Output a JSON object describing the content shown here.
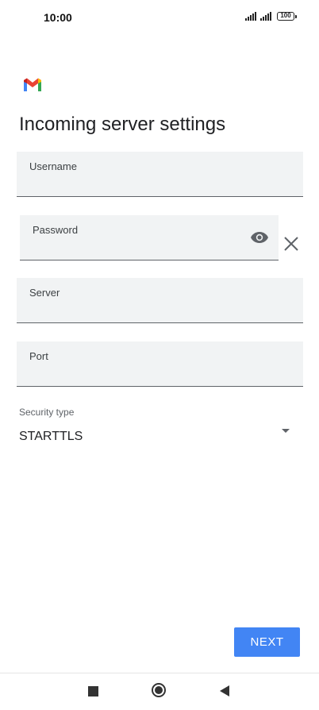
{
  "status_bar": {
    "time": "10:00",
    "battery": "100",
    "signal_icons": [
      "signal-icon",
      "signal-icon"
    ]
  },
  "app": {
    "logo_icon": "gmail-logo-icon"
  },
  "page": {
    "title": "Incoming server settings"
  },
  "fields": {
    "username": {
      "label": "Username",
      "value": ""
    },
    "password": {
      "label": "Password",
      "value": "",
      "toggle_icon": "eye-icon",
      "clear_icon": "close-icon"
    },
    "server": {
      "label": "Server",
      "value": ""
    },
    "port": {
      "label": "Port",
      "value": ""
    }
  },
  "security": {
    "label": "Security type",
    "selected": "STARTTLS"
  },
  "actions": {
    "next_label": "NEXT"
  },
  "nav_bar": {
    "icons": [
      "recents-icon",
      "home-icon",
      "back-icon"
    ]
  },
  "colors": {
    "accent": "#4285f4",
    "field_bg": "#f1f3f4"
  }
}
